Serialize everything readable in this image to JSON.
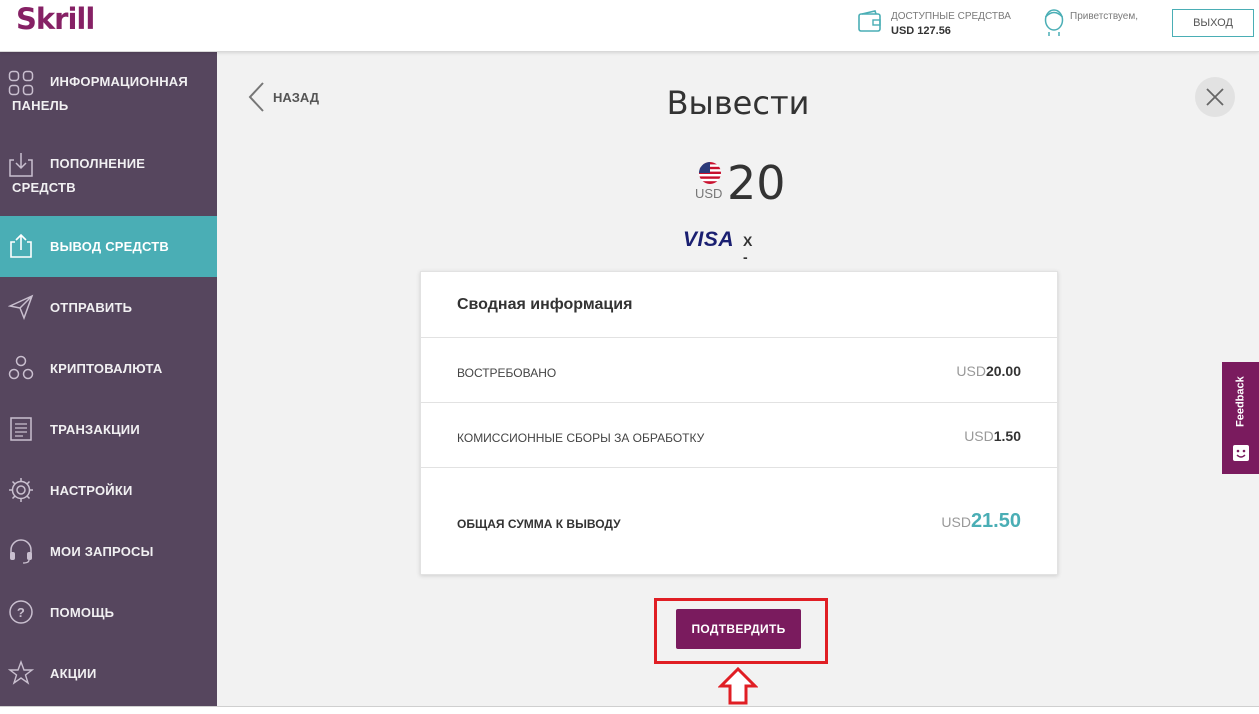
{
  "header": {
    "logo": "Skrill",
    "funds_label": "ДОСТУПНЫЕ СРЕДСТВА",
    "funds_value": "USD 127.56",
    "greeting": "Приветствуем,",
    "logout_label": "ВЫХОД"
  },
  "sidebar": {
    "items": [
      {
        "label": "ИНФОРМАЦИОННАЯ ПАНЕЛЬ",
        "icon": "dashboard-icon"
      },
      {
        "label": "ПОПОЛНЕНИЕ СРЕДСТВ",
        "icon": "deposit-icon"
      },
      {
        "label": "ВЫВОД СРЕДСТВ",
        "icon": "withdraw-icon",
        "active": true
      },
      {
        "label": "ОТПРАВИТЬ",
        "icon": "send-icon"
      },
      {
        "label": "КРИПТОВАЛЮТА",
        "icon": "crypto-icon"
      },
      {
        "label": "ТРАНЗАКЦИИ",
        "icon": "transactions-icon"
      },
      {
        "label": "НАСТРОЙКИ",
        "icon": "settings-icon"
      },
      {
        "label": "МОИ ЗАПРОСЫ",
        "icon": "headset-icon"
      },
      {
        "label": "ПОМОЩЬ",
        "icon": "help-icon"
      },
      {
        "label": "АКЦИИ",
        "icon": "star-icon"
      }
    ]
  },
  "main": {
    "back_label": "НАЗАД",
    "title": "Вывести",
    "currency_code": "USD",
    "amount": "20",
    "card_brand": "VISA",
    "card_mask": "X -",
    "summary": {
      "title": "Сводная информация",
      "rows": [
        {
          "label": "ВОСТРЕБОВАНО",
          "currency": "USD",
          "value": "20.00"
        },
        {
          "label": "КОМИССИОННЫЕ СБОРЫ ЗА ОБРАБОТКУ",
          "currency": "USD",
          "value": "1.50"
        }
      ],
      "total_label": "ОБЩАЯ СУММА К ВЫВОДУ",
      "total_currency": "USD",
      "total_value": "21.50"
    },
    "confirm_label": "ПОДТВЕРДИТЬ"
  },
  "feedback": {
    "label": "Feedback"
  },
  "colors": {
    "brand": "#862165",
    "sidebar": "#56465e",
    "accent": "#4aaeb5",
    "button": "#7a1b5e",
    "highlight": "#e01e24"
  }
}
